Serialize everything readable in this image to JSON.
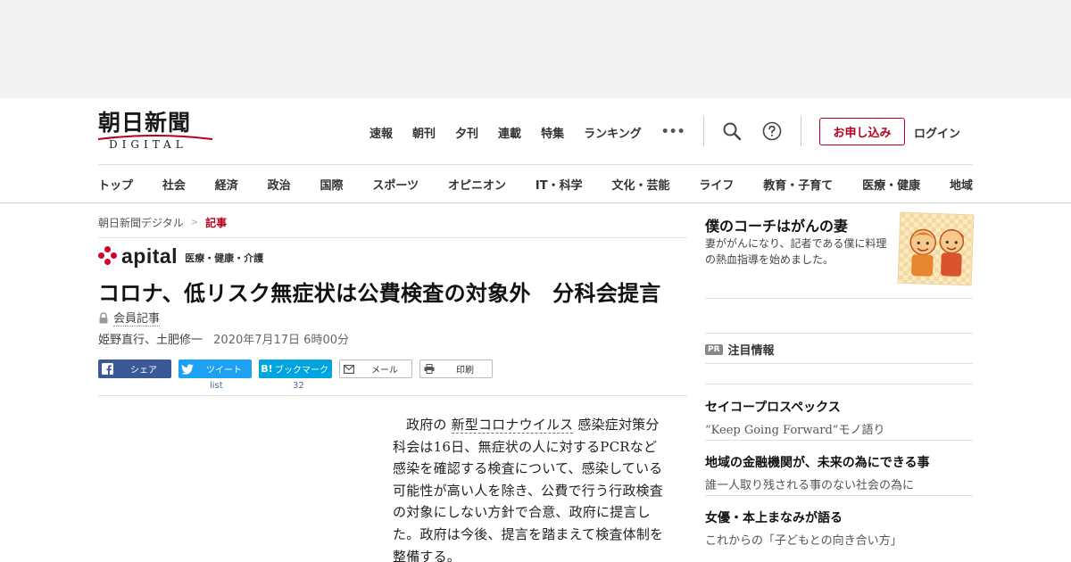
{
  "logo": {
    "name_jp": "朝日新聞",
    "name_en": "DIGITAL"
  },
  "top_nav": [
    "速報",
    "朝刊",
    "夕刊",
    "連載",
    "特集",
    "ランキング"
  ],
  "more_label": "•••",
  "subscribe_label": "お申し込み",
  "login_label": "ログイン",
  "categories": [
    "トップ",
    "社会",
    "経済",
    "政治",
    "国際",
    "スポーツ",
    "オピニオン",
    "IT・科学",
    "文化・芸能",
    "ライフ",
    "教育・子育て",
    "医療・健康",
    "地域"
  ],
  "breadcrumb": {
    "home": "朝日新聞デジタル",
    "sep": ">",
    "current": "記事"
  },
  "section": {
    "brand": "apital",
    "tag": "医療・健康・介護"
  },
  "article": {
    "title": "コロナ、低リスク無症状は公費検査の対象外　分科会提言",
    "member_label": "会員記事",
    "authors": "姫野直行、土肥修一",
    "date": "2020年7月17日 6時00分",
    "body_pre": "政府の",
    "body_keyword": "新型コロナウイルス",
    "body_post": "感染症対策分科会は16日、無症状の人に対するPCRなど感染を確認する検査について、感染している可能性が高い人を除き、公費で行う行政検査の対象にしない方針で合意、政府に提言した。政府は今後、提言を踏まえて検査体制を整備する。"
  },
  "share": {
    "facebook": "シェア",
    "twitter": "ツイート",
    "twitter_count": "list",
    "hatena_icon": "B!",
    "hatena": "ブックマーク",
    "hatena_count": "32",
    "mail": "メール",
    "print": "印刷"
  },
  "sidebar": {
    "promo_title": "僕のコーチはがんの妻",
    "promo_desc": "妻ががんになり、記者である僕に料理の熱血指導を始めました。",
    "pr_badge": "PR",
    "pr_label": "注目情報",
    "pr_items": [
      {
        "title": "セイコープロスペックス",
        "desc": "“Keep Going Forward”モノ語り"
      },
      {
        "title": "地域の金融機関が、未来の為にできる事",
        "desc": "誰一人取り残される事のない社会の為に"
      },
      {
        "title": "女優・本上まなみが語る",
        "desc": "これからの「子どもとの向き合い方」"
      }
    ]
  },
  "colors": {
    "brand_red": "#b5001d",
    "facebook": "#3b5998",
    "twitter": "#1da1f2",
    "hatena": "#00a4de"
  }
}
